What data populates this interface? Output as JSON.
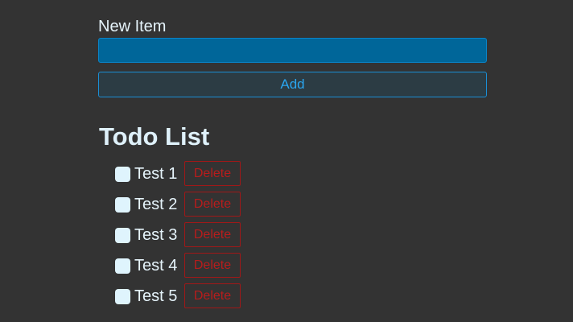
{
  "form": {
    "label": "New Item",
    "input_value": "",
    "input_placeholder": "",
    "add_label": "Add"
  },
  "list": {
    "title": "Todo List",
    "items": [
      {
        "text": "Test 1",
        "checked": false,
        "delete_label": "Delete"
      },
      {
        "text": "Test 2",
        "checked": false,
        "delete_label": "Delete"
      },
      {
        "text": "Test 3",
        "checked": false,
        "delete_label": "Delete"
      },
      {
        "text": "Test 4",
        "checked": false,
        "delete_label": "Delete"
      },
      {
        "text": "Test 5",
        "checked": false,
        "delete_label": "Delete"
      }
    ]
  },
  "colors": {
    "background": "#333333",
    "input_fill": "#006699",
    "accent_blue": "#2aa6f0",
    "delete_red": "#b81c1c",
    "text_light": "#e6f4fb"
  }
}
